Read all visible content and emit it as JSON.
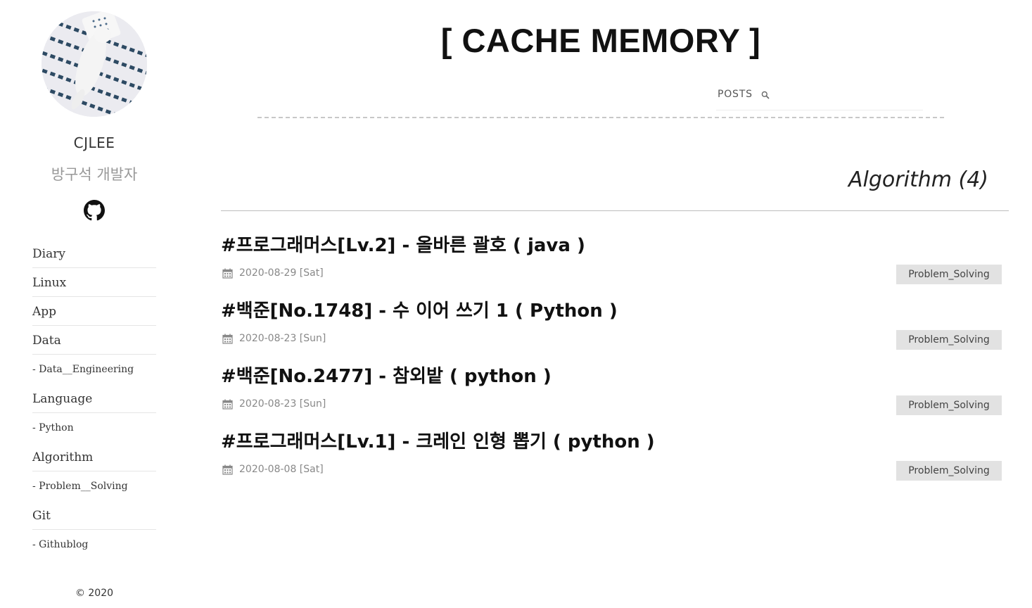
{
  "site": {
    "title": "[ CACHE MEMORY ]"
  },
  "author": {
    "name": "CJLEE",
    "description": "방구석 개발자",
    "github_icon": "github-icon"
  },
  "search": {
    "label": "POSTS",
    "icon": "search-icon",
    "placeholder": ""
  },
  "nav": {
    "items": [
      {
        "label": "Diary",
        "level": "category"
      },
      {
        "label": "Linux",
        "level": "category"
      },
      {
        "label": "App",
        "level": "category"
      },
      {
        "label": "Data",
        "level": "category"
      },
      {
        "label": "- Data__Engineering",
        "level": "sub"
      },
      {
        "label": "Language",
        "level": "category"
      },
      {
        "label": "- Python",
        "level": "sub"
      },
      {
        "label": "Algorithm",
        "level": "category"
      },
      {
        "label": "- Problem__Solving",
        "level": "sub"
      },
      {
        "label": "Git",
        "level": "category"
      },
      {
        "label": "- Githublog",
        "level": "sub"
      }
    ]
  },
  "footer": {
    "copyright": "© 2020"
  },
  "main": {
    "category_heading": "Algorithm (4)",
    "posts": [
      {
        "title": "#프로그래머스[Lv.2] - 올바른 괄호 ( java )",
        "date": "2020-08-29 [Sat]",
        "tag": "Problem_Solving"
      },
      {
        "title": "#백준[No.1748] - 수 이어 쓰기 1 ( Python )",
        "date": "2020-08-23 [Sun]",
        "tag": "Problem_Solving"
      },
      {
        "title": "#백준[No.2477] - 참외밭 ( python )",
        "date": "2020-08-23 [Sun]",
        "tag": "Problem_Solving"
      },
      {
        "title": "#프로그래머스[Lv.1] - 크레인 인형 뽑기 ( python )",
        "date": "2020-08-08 [Sat]",
        "tag": "Problem_Solving"
      }
    ]
  }
}
